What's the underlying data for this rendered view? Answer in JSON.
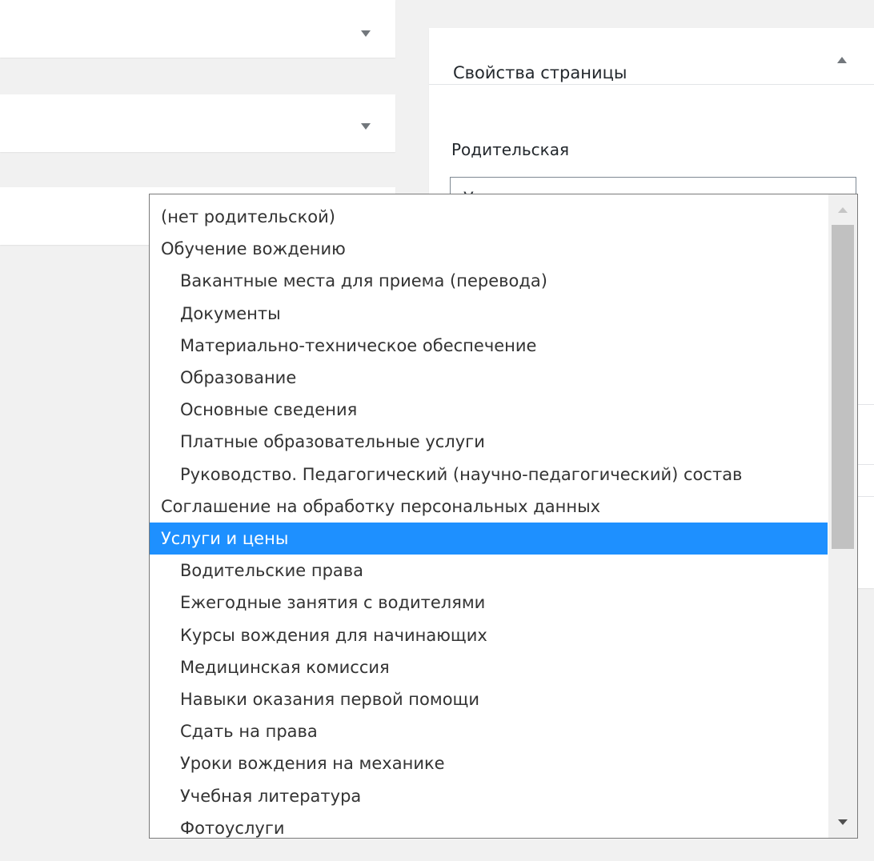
{
  "page_attributes": {
    "title": "Свойства страницы",
    "parent_label": "Родительская",
    "parent_selected": "Услуги и цены"
  },
  "dropdown": {
    "options": [
      {
        "label": "(нет родительской)",
        "level": 0,
        "selected": false
      },
      {
        "label": "Обучение вождению",
        "level": 0,
        "selected": false
      },
      {
        "label": "Вакантные места для приема (перевода)",
        "level": 1,
        "selected": false
      },
      {
        "label": "Документы",
        "level": 1,
        "selected": false
      },
      {
        "label": "Материально-техническое обеспечение",
        "level": 1,
        "selected": false
      },
      {
        "label": "Образование",
        "level": 1,
        "selected": false
      },
      {
        "label": "Основные сведения",
        "level": 1,
        "selected": false
      },
      {
        "label": "Платные образовательные услуги",
        "level": 1,
        "selected": false
      },
      {
        "label": "Руководство. Педагогический (научно-педагогический) состав",
        "level": 1,
        "selected": false
      },
      {
        "label": "Соглашение на обработку персональных данных",
        "level": 0,
        "selected": false
      },
      {
        "label": "Услуги и цены",
        "level": 0,
        "selected": true
      },
      {
        "label": "Водительские права",
        "level": 1,
        "selected": false
      },
      {
        "label": "Ежегодные занятия с водителями",
        "level": 1,
        "selected": false
      },
      {
        "label": "Курсы вождения для начинающих",
        "level": 1,
        "selected": false
      },
      {
        "label": "Медицинская комиссия",
        "level": 1,
        "selected": false
      },
      {
        "label": "Навыки оказания первой помощи",
        "level": 1,
        "selected": false
      },
      {
        "label": "Сдать на права",
        "level": 1,
        "selected": false
      },
      {
        "label": "Уроки вождения на механике",
        "level": 1,
        "selected": false
      },
      {
        "label": "Учебная литература",
        "level": 1,
        "selected": false
      },
      {
        "label": "Фотоуслуги",
        "level": 1,
        "selected": false
      }
    ]
  },
  "icons": {
    "collapse_toggle_1": "caret-down-icon",
    "collapse_toggle_2": "caret-down-icon",
    "panel_toggle": "caret-up-icon",
    "select_arrow": "caret-down-icon"
  },
  "colors": {
    "selected_bg": "#1e90ff",
    "selected_text": "#ffffff",
    "background": "#f1f1f1",
    "panel_bg": "#ffffff"
  }
}
